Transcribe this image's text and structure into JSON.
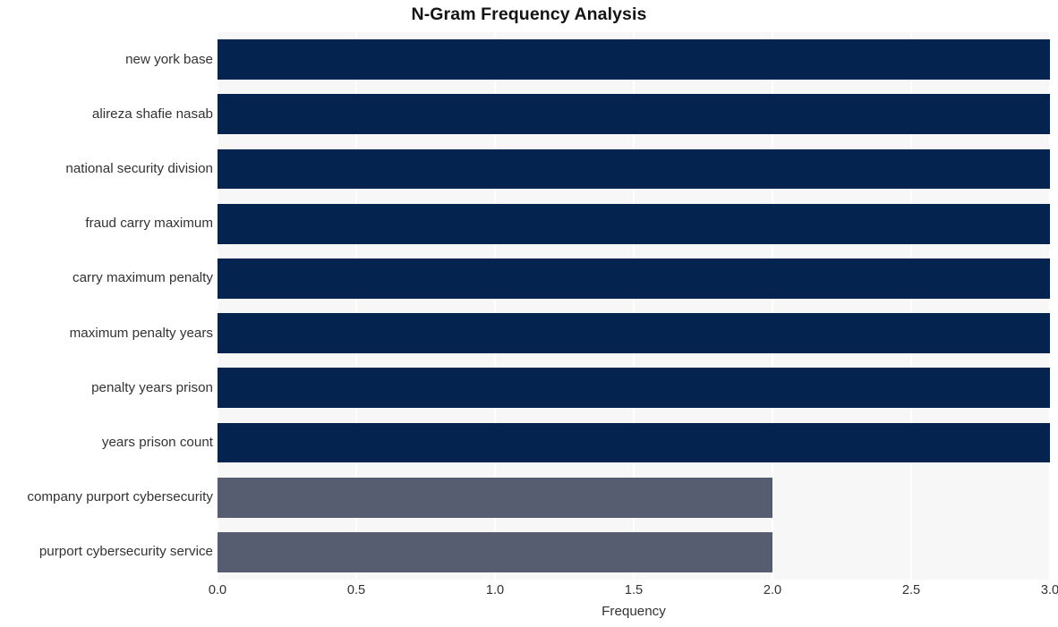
{
  "chart_data": {
    "type": "bar",
    "orientation": "horizontal",
    "title": "N-Gram Frequency Analysis",
    "xlabel": "Frequency",
    "ylabel": "",
    "xlim": [
      0.0,
      3.0
    ],
    "xticks": [
      "0.0",
      "0.5",
      "1.0",
      "1.5",
      "2.0",
      "2.5",
      "3.0"
    ],
    "xtick_values": [
      0.0,
      0.5,
      1.0,
      1.5,
      2.0,
      2.5,
      3.0
    ],
    "grid": true,
    "grid_axis": "x",
    "legend": "none",
    "categories": [
      "new york base",
      "alireza shafie nasab",
      "national security division",
      "fraud carry maximum",
      "carry maximum penalty",
      "maximum penalty years",
      "penalty years prison",
      "years prison count",
      "company purport cybersecurity",
      "purport cybersecurity service"
    ],
    "values": [
      3,
      3,
      3,
      3,
      3,
      3,
      3,
      3,
      2,
      2
    ],
    "bar_colors": [
      "#04234f",
      "#04234f",
      "#04234f",
      "#04234f",
      "#04234f",
      "#04234f",
      "#04234f",
      "#04234f",
      "#575d70",
      "#575d70"
    ]
  },
  "style": {
    "plot_background": "#f7f7f7",
    "figure_background": "#ffffff",
    "gridline_color": "#ffffff",
    "text_color": "#333333",
    "title_color": "#141414",
    "color_high": "#04234f",
    "color_low": "#575d70"
  }
}
